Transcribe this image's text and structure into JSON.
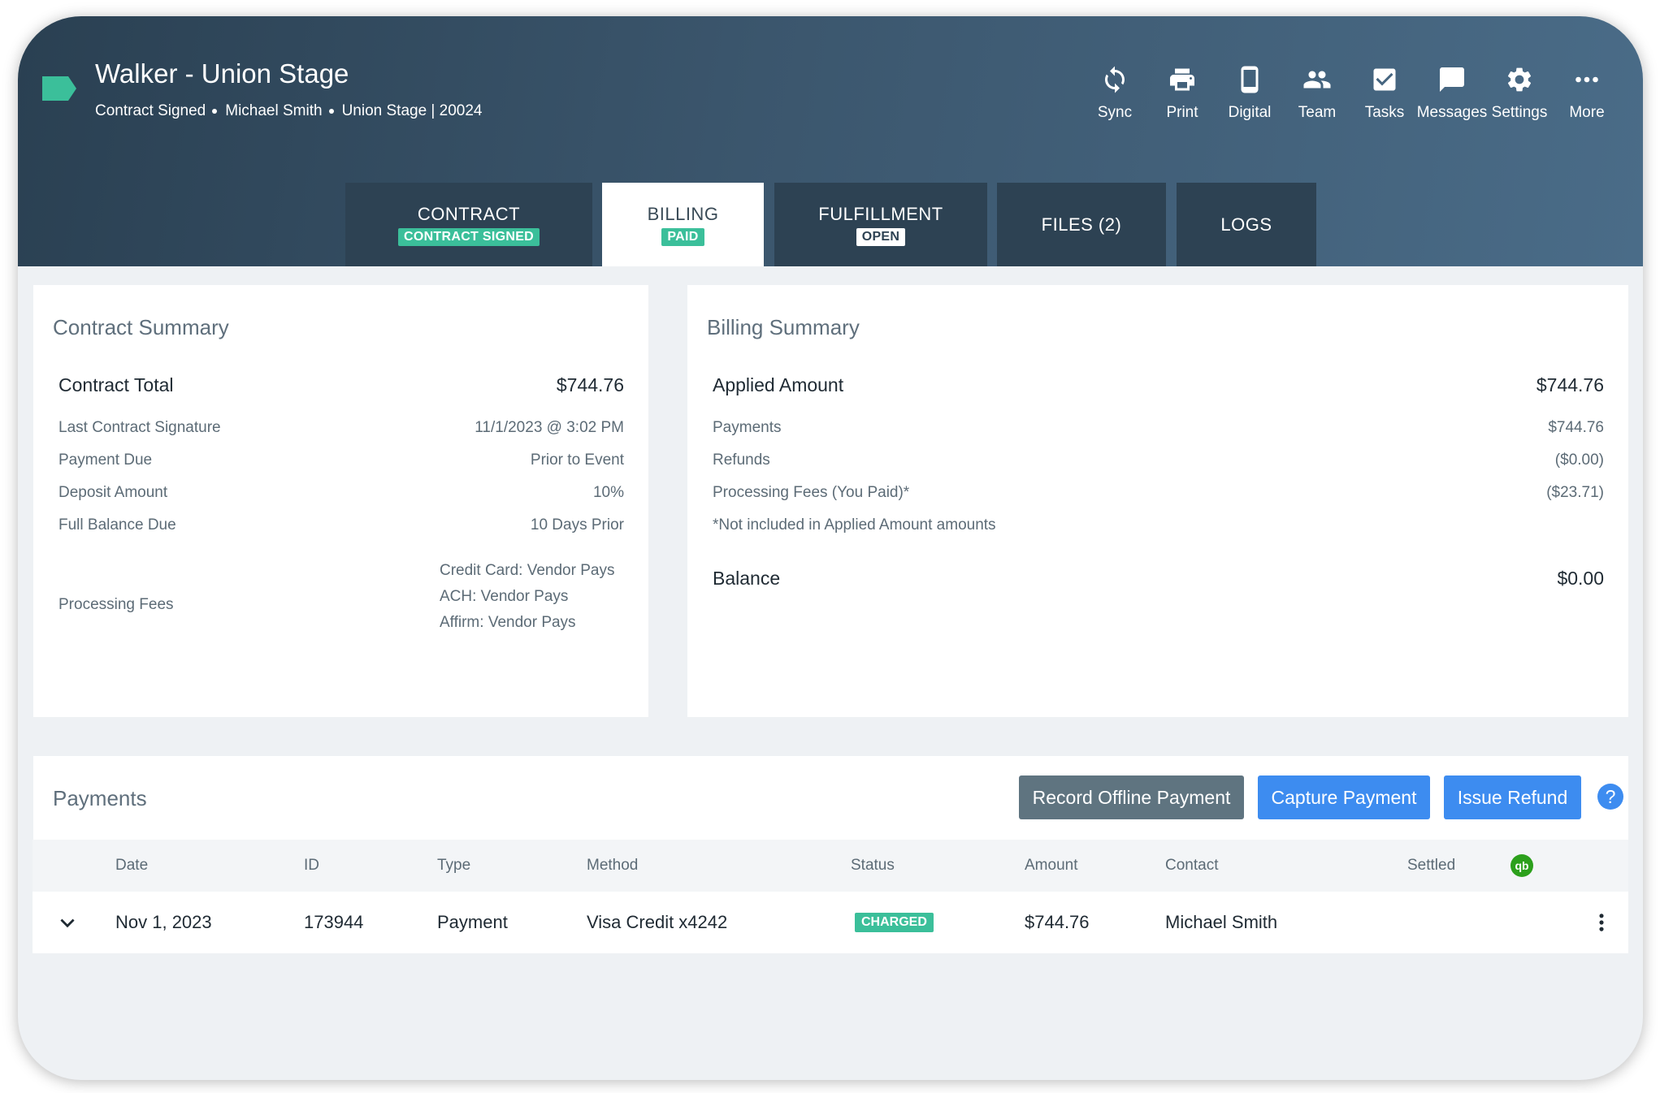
{
  "header": {
    "title": "Walker - Union Stage",
    "meta": [
      "Contract Signed",
      "Michael Smith",
      "Union Stage | 20024"
    ],
    "tag_color": "#3bbf9a"
  },
  "toolbar": [
    {
      "label": "Sync",
      "icon": "sync-icon"
    },
    {
      "label": "Print",
      "icon": "print-icon"
    },
    {
      "label": "Digital",
      "icon": "phone-icon"
    },
    {
      "label": "Team",
      "icon": "team-icon"
    },
    {
      "label": "Tasks",
      "icon": "checkbox-icon"
    },
    {
      "label": "Messages",
      "icon": "message-icon"
    },
    {
      "label": "Settings",
      "icon": "gear-icon"
    },
    {
      "label": "More",
      "icon": "more-icon"
    }
  ],
  "tabs": [
    {
      "label": "CONTRACT",
      "badge": "CONTRACT SIGNED"
    },
    {
      "label": "BILLING",
      "badge": "PAID"
    },
    {
      "label": "FULFILLMENT",
      "badge": "OPEN"
    },
    {
      "label": "FILES (2)",
      "badge": ""
    },
    {
      "label": "LOGS",
      "badge": ""
    }
  ],
  "active_tab": "BILLING",
  "contract_summary": {
    "title": "Contract Summary",
    "total_label": "Contract Total",
    "total_value": "$744.76",
    "rows": [
      {
        "label": "Last Contract Signature",
        "value": "11/1/2023 @ 3:02 PM"
      },
      {
        "label": "Payment Due",
        "value": "Prior to Event"
      },
      {
        "label": "Deposit Amount",
        "value": "10%"
      },
      {
        "label": "Full Balance Due",
        "value": "10 Days Prior"
      }
    ],
    "fees_label": "Processing Fees",
    "fees": [
      "Credit Card: Vendor Pays",
      "ACH: Vendor Pays",
      "Affirm: Vendor Pays"
    ]
  },
  "billing_summary": {
    "title": "Billing Summary",
    "applied_label": "Applied Amount",
    "applied_value": "$744.76",
    "rows": [
      {
        "label": "Payments",
        "value": "$744.76"
      },
      {
        "label": "Refunds",
        "value": "($0.00)"
      },
      {
        "label": "Processing Fees (You Paid)*",
        "value": "($23.71)"
      }
    ],
    "note": "*Not included in Applied Amount amounts",
    "balance_label": "Balance",
    "balance_value": "$0.00"
  },
  "payments": {
    "title": "Payments",
    "buttons": {
      "record": "Record Offline Payment",
      "capture": "Capture Payment",
      "refund": "Issue Refund"
    },
    "columns": [
      "Date",
      "ID",
      "Type",
      "Method",
      "Status",
      "Amount",
      "Contact",
      "Settled"
    ],
    "rows": [
      {
        "date": "Nov 1, 2023",
        "id": "173944",
        "type": "Payment",
        "method": "Visa Credit x4242",
        "status": "CHARGED",
        "amount": "$744.76",
        "contact": "Michael Smith"
      }
    ]
  },
  "colors": {
    "accent_green": "#3bbf9a",
    "button_blue": "#3d8cf0",
    "button_gray": "#5f7480",
    "header_dark": "#2a4052"
  }
}
